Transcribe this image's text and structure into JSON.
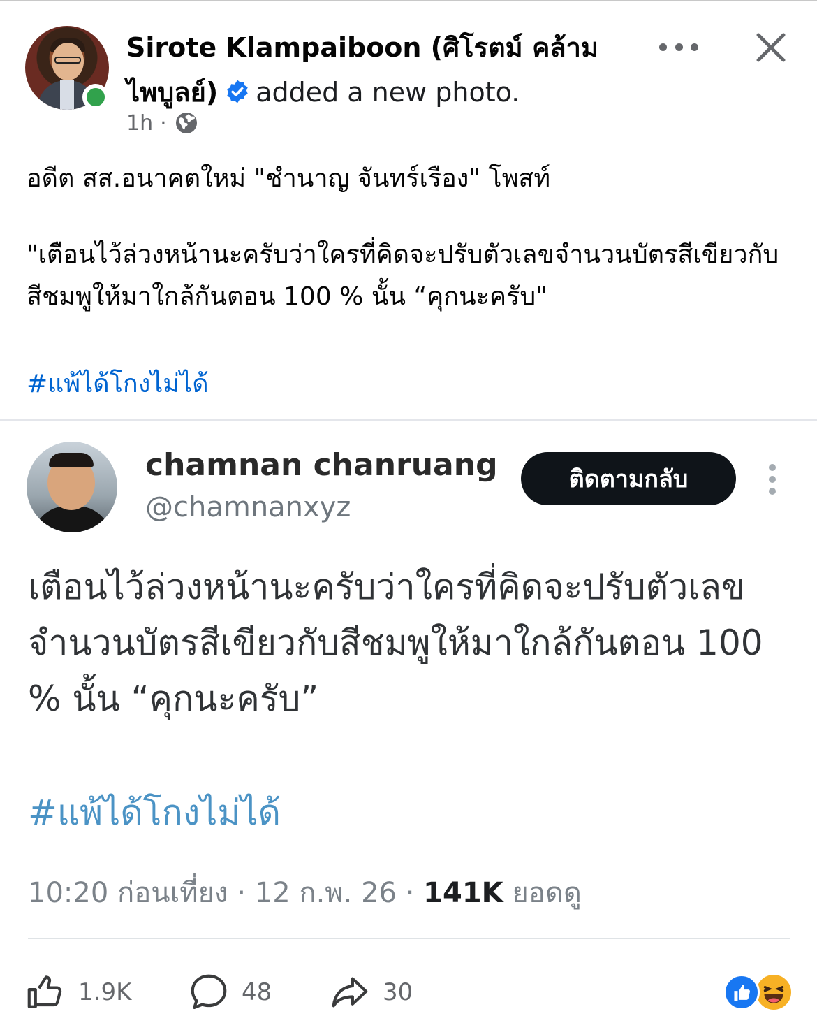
{
  "post": {
    "author": "Sirote Klampaiboon (ศิโรตม์ คล้ามไพบูลย์)",
    "action": "added a new photo.",
    "time": "1h",
    "separator": "·",
    "text_line1": "อดีต สส.อนาคตใหม่ \"ชำนาญ จันทร์เรือง\" โพสท์",
    "text_line2": "\"เตือนไว้ล่วงหน้านะครับว่าใครที่คิดจะปรับตัวเลขจำนวนบัตรสีเขียวกับสีชมพูให้มาใกล้กันตอน 100 % นั้น “คุกนะครับ\"",
    "hashtag": "#แพ้ได้โกงไม่ได้"
  },
  "tweet": {
    "name": "chamnan chanruang",
    "handle": "@chamnanxyz",
    "follow_label": "ติดตามกลับ",
    "text": "เตือนไว้ล่วงหน้านะครับว่าใครที่คิดจะปรับตัวเลขจำนวนบัตรสีเขียวกับสีชมพูให้มาใกล้กันตอน 100 % นั้น “คุกนะครับ”",
    "hashtag": "#แพ้ได้โกงไม่ได้",
    "time": "10:20 ก่อนเที่ยง",
    "date": "12 ก.พ. 26",
    "views": "141K",
    "views_label": "ยอดดู",
    "separator": "·"
  },
  "actions": {
    "likes": "1.9K",
    "comments": "48",
    "shares": "30"
  },
  "icons": {
    "verified": "verified-badge-icon",
    "audience": "globe-icon",
    "more": "more-options-icon",
    "close": "close-icon",
    "like": "thumbs-up-icon",
    "comment": "comment-bubble-icon",
    "share": "share-arrow-icon"
  },
  "colors": {
    "link": "#0064d1",
    "tweet_hashtag": "#4b93c5",
    "follow_button": "#0f1419",
    "online": "#31a24c",
    "verified": "#1877f2"
  }
}
